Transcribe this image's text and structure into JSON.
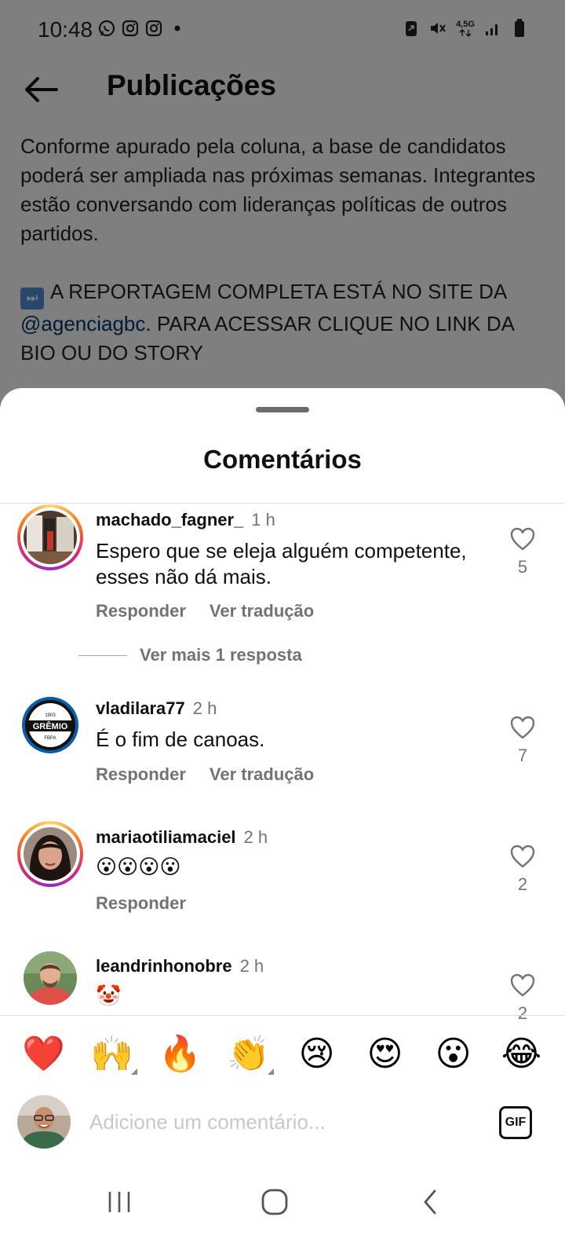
{
  "status_bar": {
    "time": "10:48",
    "network_label": "4,5G",
    "icons": [
      "whatsapp-icon",
      "instagram-icon",
      "instagram-icon",
      "dot-icon",
      "battery-saver-icon",
      "mute-icon",
      "signal-icon",
      "battery-icon"
    ]
  },
  "header": {
    "title": "Publicações"
  },
  "caption": {
    "paragraph1": "Conforme apurado pela coluna, a base de candidatos poderá ser ampliada nas próximas semanas. Integrantes estão conversando com lideranças políticas de outros partidos.",
    "paragraph2_prefix": "A REPORTAGEM COMPLETA ESTÁ NO SITE DA",
    "paragraph2_link": "@agenciagbc",
    "paragraph2_suffix": ". PARA ACESSAR CLIQUE NO LINK DA BIO OU DO STORY"
  },
  "sheet": {
    "title": "Comentários"
  },
  "comments": [
    {
      "username": "machado_fagner_",
      "time": "1 h",
      "text": "Espero que se eleja alguém competente, esses não dá mais.",
      "reply_label": "Responder",
      "translate_label": "Ver tradução",
      "likes": "5",
      "more_replies": "Ver mais 1 resposta"
    },
    {
      "username": "vladilara77",
      "time": "2 h",
      "text": "É o fim de canoas.",
      "reply_label": "Responder",
      "translate_label": "Ver tradução",
      "likes": "7"
    },
    {
      "username": "mariaotiliamaciel",
      "time": "2 h",
      "text": "😮😮😮😮",
      "reply_label": "Responder",
      "likes": "2"
    },
    {
      "username": "leandrinhonobre",
      "time": "2 h",
      "text": "🤡",
      "likes": "2"
    }
  ],
  "reactions": [
    "❤️",
    "🙌",
    "🔥",
    "👏",
    "😢",
    "😍",
    "😮",
    "😂"
  ],
  "input": {
    "placeholder": "Adicione um comentário...",
    "gif_label": "GIF"
  },
  "colors": {
    "link": "#00376b",
    "secondary_text": "#737373",
    "overlay": "rgba(0,0,0,0.5)"
  }
}
